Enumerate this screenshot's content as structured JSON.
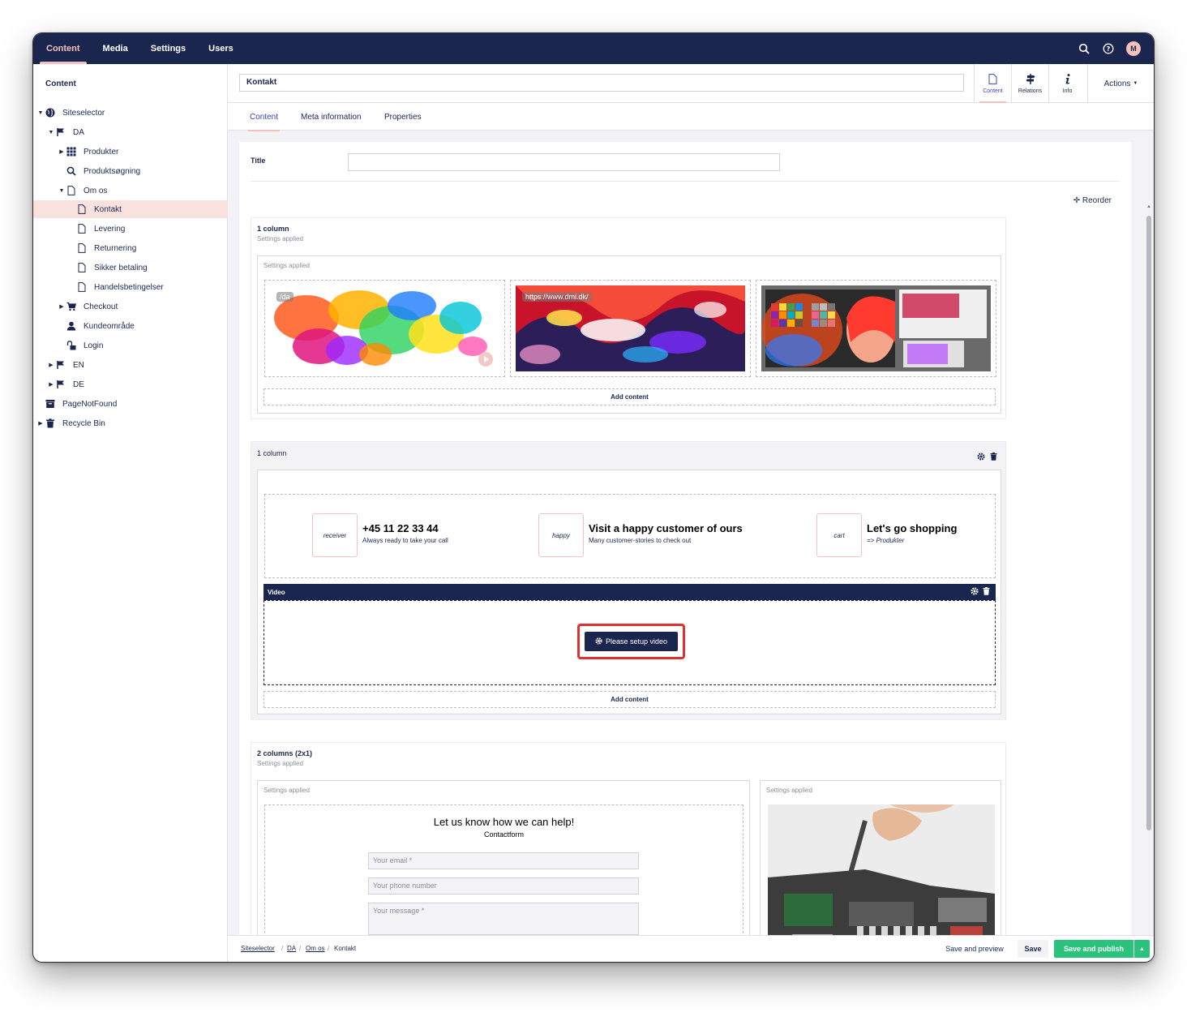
{
  "topnav": {
    "items": [
      {
        "label": "Content",
        "active": true
      },
      {
        "label": "Media",
        "active": false
      },
      {
        "label": "Settings",
        "active": false
      },
      {
        "label": "Users",
        "active": false
      }
    ],
    "avatar_initial": "M"
  },
  "sidebar": {
    "title": "Content",
    "tree": [
      {
        "label": "Siteselector",
        "icon": "globe-icon"
      },
      {
        "label": "DA",
        "icon": "flag-icon"
      },
      {
        "label": "Produkter",
        "icon": "grid-icon"
      },
      {
        "label": "Produktsøgning",
        "icon": "search-icon"
      },
      {
        "label": "Om os",
        "icon": "document-icon"
      },
      {
        "label": "Kontakt",
        "icon": "document-icon"
      },
      {
        "label": "Levering",
        "icon": "document-icon"
      },
      {
        "label": "Returnering",
        "icon": "document-icon"
      },
      {
        "label": "Sikker betaling",
        "icon": "document-icon"
      },
      {
        "label": "Handelsbetingelser",
        "icon": "document-icon"
      },
      {
        "label": "Checkout",
        "icon": "cart-icon"
      },
      {
        "label": "Kundeområde",
        "icon": "user-icon"
      },
      {
        "label": "Login",
        "icon": "unlock-icon"
      },
      {
        "label": "EN",
        "icon": "flag-icon"
      },
      {
        "label": "DE",
        "icon": "flag-icon"
      },
      {
        "label": "PageNotFound",
        "icon": "box-icon"
      },
      {
        "label": "Recycle Bin",
        "icon": "trash-icon"
      }
    ]
  },
  "header": {
    "name_value": "Kontakt",
    "apps": [
      {
        "label": "Content",
        "icon": "document-icon",
        "active": true
      },
      {
        "label": "Relations",
        "icon": "signpost-icon",
        "active": false
      },
      {
        "label": "Info",
        "icon": "info-icon",
        "active": false
      }
    ],
    "actions_label": "Actions"
  },
  "tabs": [
    "Content",
    "Meta information",
    "Properties"
  ],
  "editor": {
    "title_label": "Title",
    "title_value": "",
    "reorder_label": "Reorder",
    "row1": {
      "title": "1 column",
      "subtitle": "Settings applied",
      "area_label": "Settings applied",
      "image1_url": "/da",
      "image2_url": "https://www.dmi.dk/",
      "add_content": "Add content"
    },
    "row2": {
      "title": "1 column",
      "features": [
        {
          "icon_text": "receiver",
          "title": "+45 11 22 33 44",
          "subtitle": "Always ready to take your call"
        },
        {
          "icon_text": "happy",
          "title": "Visit a happy customer of ours",
          "subtitle": "Many customer-stories to check out"
        },
        {
          "icon_text": "cart",
          "title": "Let's go shopping",
          "subtitle": "=> Produkter"
        }
      ],
      "video_label": "Video",
      "setup_video_label": "Please setup video",
      "add_content": "Add content"
    },
    "row3": {
      "title": "2 columns (2x1)",
      "subtitle": "Settings applied",
      "left_area_label": "Settings applied",
      "right_area_label": "Settings applied",
      "form_heading": "Let us know how we can help!",
      "form_subheading": "Contactform",
      "email_placeholder": "Your email *",
      "phone_placeholder": "Your phone number",
      "message_placeholder": "Your message *"
    }
  },
  "footer": {
    "breadcrumb": [
      "Siteselector",
      "DA",
      "Om os",
      "Kontakt"
    ],
    "save_preview": "Save and preview",
    "save": "Save",
    "save_publish": "Save and publish"
  },
  "colors": {
    "primary": "#1b264f",
    "accent_pink": "#f5c1bc",
    "selected_bg": "#f9e1de",
    "active_blue": "#3544b1",
    "success": "#2bc37c",
    "highlight_red": "#e03131"
  }
}
